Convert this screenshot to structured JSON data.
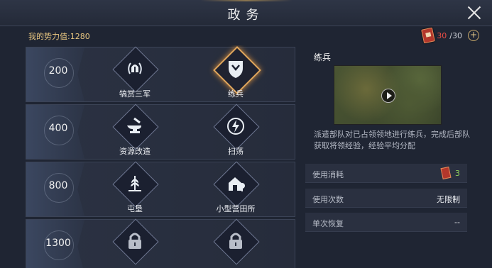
{
  "window": {
    "title": "政务",
    "close_icon": "close-icon"
  },
  "header": {
    "power_label": "我的势力值:",
    "power_value": "1280",
    "stamina_current": "30",
    "stamina_max": "/30",
    "stamina_icon": "order-token-icon",
    "add_icon": "plus-icon"
  },
  "tasks": [
    {
      "cost": "200",
      "items": [
        {
          "label": "犒赏三军",
          "icon": "helmet-laurel-icon",
          "selected": false,
          "locked": false
        },
        {
          "label": "练兵",
          "icon": "shield-icon",
          "selected": true,
          "locked": false
        }
      ]
    },
    {
      "cost": "400",
      "items": [
        {
          "label": "资源改造",
          "icon": "anvil-icon",
          "selected": false,
          "locked": false
        },
        {
          "label": "扫荡",
          "icon": "lightning-icon",
          "selected": false,
          "locked": false
        }
      ]
    },
    {
      "cost": "800",
      "items": [
        {
          "label": "屯垦",
          "icon": "wheat-icon",
          "selected": false,
          "locked": false
        },
        {
          "label": "小型营田所",
          "icon": "house-icon",
          "selected": false,
          "locked": false
        }
      ]
    },
    {
      "cost": "1300",
      "items": [
        {
          "label": "",
          "icon": "lock-icon",
          "selected": false,
          "locked": true
        },
        {
          "label": "",
          "icon": "lock-icon",
          "selected": false,
          "locked": true
        }
      ]
    }
  ],
  "detail": {
    "name": "练兵",
    "preview_icon": "play-icon",
    "description": "派遣部队对已占领领地进行练兵，完成后部队获取将领经验，经验平均分配",
    "rows": [
      {
        "key": "使用消耗",
        "value": "3",
        "icon": "order-token-icon"
      },
      {
        "key": "使用次数",
        "value": "无限制"
      },
      {
        "key": "单次恢复",
        "value": "--"
      }
    ]
  },
  "colors": {
    "accent": "#e0a65c",
    "cost_red": "#ee4e45",
    "gold_text": "#e8c680",
    "green_value": "#8fd15c"
  }
}
